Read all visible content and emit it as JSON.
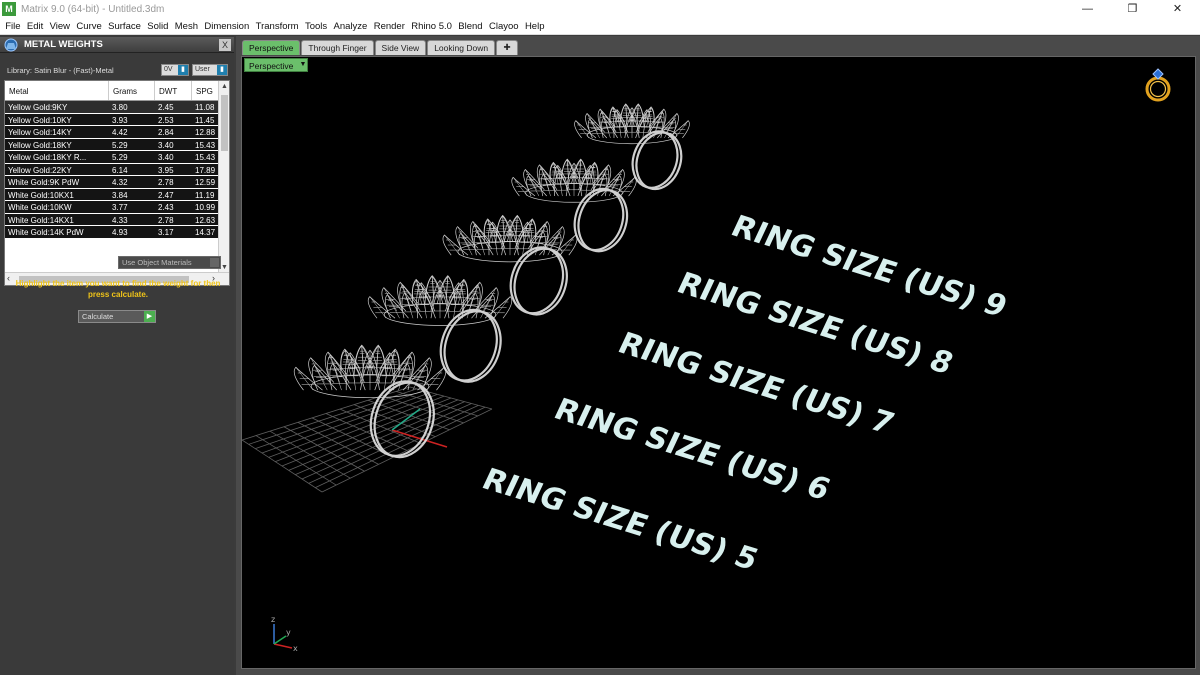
{
  "window": {
    "title": "Matrix 9.0 (64-bit) - Untitled.3dm",
    "app_icon": "matrix-logo-icon",
    "controls": [
      "minimize-icon",
      "maximize-icon",
      "close-icon"
    ]
  },
  "menu": [
    "File",
    "Edit",
    "View",
    "Curve",
    "Surface",
    "Solid",
    "Mesh",
    "Dimension",
    "Transform",
    "Tools",
    "Analyze",
    "Render",
    "Rhino 5.0",
    "Blend",
    "Clayoo",
    "Help"
  ],
  "panel": {
    "title": "METAL WEIGHTS",
    "close_label": "X",
    "library": "Library: Satin Blur - (Fast)-Metal",
    "toggle1": "0V",
    "toggle2": "User",
    "columns": [
      "Metal",
      "Grams",
      "DWT",
      "SPG"
    ],
    "rows": [
      [
        "Yellow Gold:9KY",
        "3.80",
        "2.45",
        "11.08"
      ],
      [
        "Yellow Gold:10KY",
        "3.93",
        "2.53",
        "11.45"
      ],
      [
        "Yellow Gold:14KY",
        "4.42",
        "2.84",
        "12.88"
      ],
      [
        "Yellow Gold:18KY",
        "5.29",
        "3.40",
        "15.43"
      ],
      [
        "Yellow Gold:18KY R...",
        "5.29",
        "3.40",
        "15.43"
      ],
      [
        "Yellow Gold:22KY",
        "6.14",
        "3.95",
        "17.89"
      ],
      [
        "White Gold:9K PdW",
        "4.32",
        "2.78",
        "12.59"
      ],
      [
        "White Gold:10KX1",
        "3.84",
        "2.47",
        "11.19"
      ],
      [
        "White Gold:10KW",
        "3.77",
        "2.43",
        "10.99"
      ],
      [
        "White Gold:14KX1",
        "4.33",
        "2.78",
        "12.63"
      ],
      [
        "White Gold:14K PdW",
        "4.93",
        "3.17",
        "14.37"
      ]
    ],
    "use_object_materials": "Use Object Materials",
    "hint": "Highlight the item you want to find the weight for then press calculate.",
    "calculate_label": "Calculate"
  },
  "viewport": {
    "tabs": [
      "Perspective",
      "Through Finger",
      "Side View",
      "Looking Down"
    ],
    "active_tab": "Perspective",
    "view_label": "Perspective",
    "ring_size_labels": [
      "RING SIZE (US)   9",
      "RING SIZE (US)   8",
      "RING SIZE (US)   7",
      "RING SIZE (US)   6",
      "RING SIZE (US)   5"
    ],
    "axis_labels": {
      "z": "z",
      "y": "y",
      "x": "x"
    },
    "colors": {
      "label_text": "#d8f0ee",
      "wireframe": "#e6e6e6",
      "grid": "#6a6a6a",
      "x_axis": "#cc2222",
      "y_axis": "#22aa88"
    }
  }
}
